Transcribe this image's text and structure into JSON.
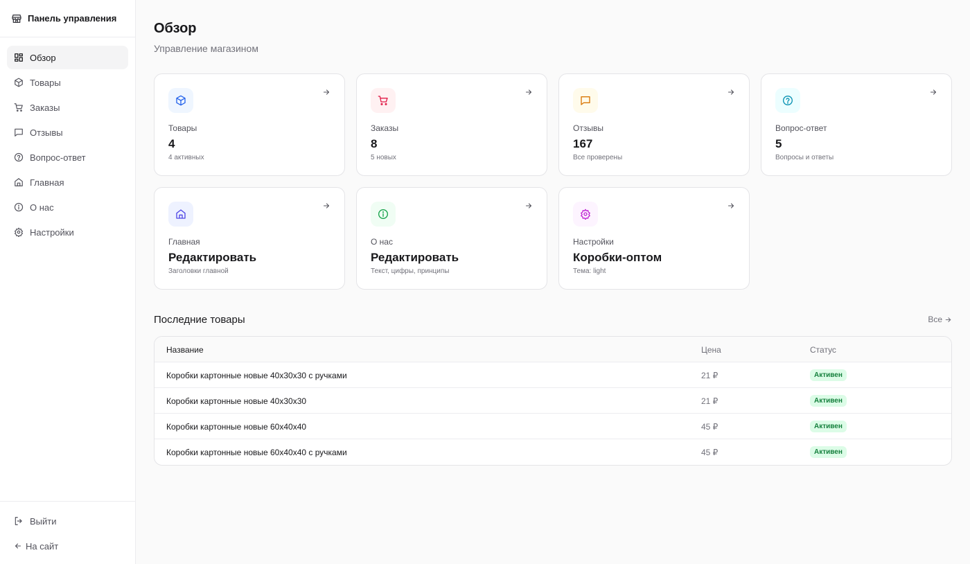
{
  "sidebar": {
    "brand": "Панель управления",
    "items": [
      {
        "label": "Обзор",
        "icon": "grid-icon",
        "active": true
      },
      {
        "label": "Товары",
        "icon": "box-icon"
      },
      {
        "label": "Заказы",
        "icon": "cart-icon"
      },
      {
        "label": "Отзывы",
        "icon": "message-icon"
      },
      {
        "label": "Вопрос-ответ",
        "icon": "question-icon"
      },
      {
        "label": "Главная",
        "icon": "home-icon"
      },
      {
        "label": "О нас",
        "icon": "info-icon"
      },
      {
        "label": "Настройки",
        "icon": "gear-icon"
      }
    ],
    "logout": "Выйти",
    "to_site": "На сайт"
  },
  "header": {
    "title": "Обзор",
    "subtitle": "Управление магазином"
  },
  "cards": [
    {
      "label": "Товары",
      "value": "4",
      "sub": "4 активных",
      "icon": "box-icon",
      "color": "#2563eb",
      "bg": "#eff6ff"
    },
    {
      "label": "Заказы",
      "value": "8",
      "sub": "5 новых",
      "icon": "cart-icon",
      "color": "#e11d48",
      "bg": "#fff1f2"
    },
    {
      "label": "Отзывы",
      "value": "167",
      "sub": "Все проверены",
      "icon": "message-icon",
      "color": "#d97706",
      "bg": "#fffbeb"
    },
    {
      "label": "Вопрос-ответ",
      "value": "5",
      "sub": "Вопросы и ответы",
      "icon": "question-icon",
      "color": "#0891b2",
      "bg": "#ecfeff"
    },
    {
      "label": "Главная",
      "value": "Редактировать",
      "sub": "Заголовки главной",
      "icon": "home-icon",
      "color": "#4f46e5",
      "bg": "#eef2ff"
    },
    {
      "label": "О нас",
      "value": "Редактировать",
      "sub": "Текст, цифры, принципы",
      "icon": "info-icon",
      "color": "#16a34a",
      "bg": "#f0fdf4"
    },
    {
      "label": "Настройки",
      "value": "Коробки-оптом",
      "sub": "Тема: light",
      "icon": "gear-icon",
      "color": "#c026d3",
      "bg": "#fdf4ff"
    }
  ],
  "recent": {
    "title": "Последние товары",
    "all_link": "Все",
    "columns": [
      "Название",
      "Цена",
      "Статус"
    ],
    "rows": [
      {
        "name": "Коробки картонные новые 40x30x30 с ручками",
        "price": "21 ₽",
        "status": "Активен"
      },
      {
        "name": "Коробки картонные новые 40x30x30",
        "price": "21 ₽",
        "status": "Активен"
      },
      {
        "name": "Коробки картонные новые 60x40x40",
        "price": "45 ₽",
        "status": "Активен"
      },
      {
        "name": "Коробки картонные новые 60x40x40 с ручками",
        "price": "45 ₽",
        "status": "Активен"
      }
    ]
  },
  "colors": {
    "badge_bg": "#dcfce7",
    "badge_text": "#15803d",
    "active_nav_bg": "#f4f4f5"
  }
}
